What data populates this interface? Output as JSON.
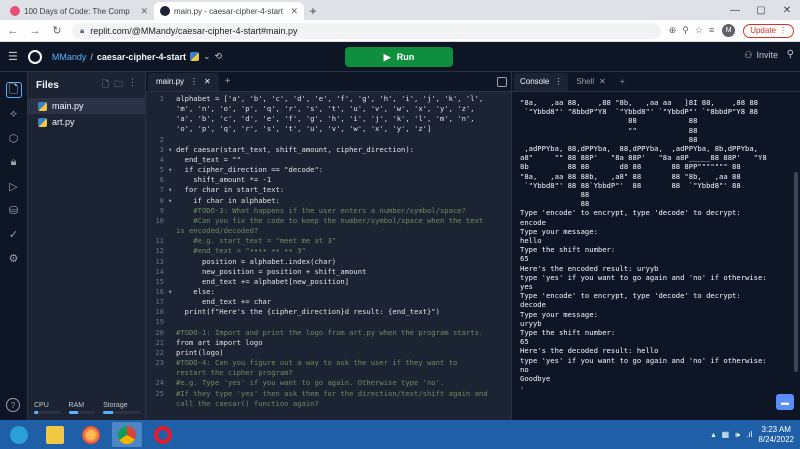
{
  "browser": {
    "tabs": [
      {
        "title": "100 Days of Code: The Comp",
        "favicon_color": "#e94e77",
        "active": false
      },
      {
        "title": "main.py - caesar-cipher-4-start",
        "favicon_color": "#1c2333",
        "active": true
      }
    ],
    "url": "replit.com/@MMandy/caesar-cipher-4-start#main.py",
    "profile_initial": "M",
    "update_label": "Update"
  },
  "header": {
    "user": "MMandy",
    "separator": "/",
    "repo": "caesar-cipher-4-start",
    "run_label": "Run",
    "invite_label": "Invite"
  },
  "files": {
    "title": "Files",
    "items": [
      {
        "name": "main.py",
        "active": true
      },
      {
        "name": "art.py",
        "active": false
      }
    ],
    "resources": [
      {
        "label": "CPU",
        "fraction": 0.15
      },
      {
        "label": "RAM",
        "fraction": 0.35
      },
      {
        "label": "Storage",
        "fraction": 0.25
      }
    ]
  },
  "editor": {
    "tab_label": "main.py",
    "lines": [
      {
        "n": "1",
        "fold": "",
        "text": "alphabet = ['a', 'b', 'c', 'd', 'e', 'f', 'g', 'h', 'i', 'j', 'k', 'l',",
        "comment": false
      },
      {
        "n": "",
        "fold": "",
        "text": "'m', 'n', 'o', 'p', 'q', 'r', 's', 't', 'u', 'v', 'w', 'x', 'y', 'z',",
        "comment": false
      },
      {
        "n": "",
        "fold": "",
        "text": "'a', 'b', 'c', 'd', 'e', 'f', 'g', 'h', 'i', 'j', 'k', 'l', 'm', 'n',",
        "comment": false
      },
      {
        "n": "",
        "fold": "",
        "text": "'o', 'p', 'q', 'r', 's', 't', 'u', 'v', 'w', 'x', 'y', 'z']",
        "comment": false
      },
      {
        "n": "2",
        "fold": "",
        "text": "",
        "comment": false
      },
      {
        "n": "3",
        "fold": "▾",
        "text": "def caesar(start_text, shift_amount, cipher_direction):",
        "comment": false
      },
      {
        "n": "4",
        "fold": "",
        "text": "  end_text = \"\"",
        "comment": false
      },
      {
        "n": "5",
        "fold": "▾",
        "text": "  if cipher_direction == \"decode\":",
        "comment": false
      },
      {
        "n": "6",
        "fold": "",
        "text": "    shift_amount *= -1",
        "comment": false
      },
      {
        "n": "7",
        "fold": "▾",
        "text": "  for char in start_text:",
        "comment": false
      },
      {
        "n": "8",
        "fold": "▾",
        "text": "    if char in alphabet:",
        "comment": false
      },
      {
        "n": "9",
        "fold": "",
        "text": "    #TODO-3: What happens if the user enters a number/symbol/space?",
        "comment": true
      },
      {
        "n": "10",
        "fold": "",
        "text": "    #Can you fix the code to keep the number/symbol/space when the text",
        "comment": true
      },
      {
        "n": "",
        "fold": "",
        "text": "is encoded/decoded?",
        "comment": true
      },
      {
        "n": "11",
        "fold": "",
        "text": "    #e.g. start_text = \"meet me at 3\"",
        "comment": true
      },
      {
        "n": "12",
        "fold": "",
        "text": "    #end_text = \"•••• •• •• 3\"",
        "comment": true
      },
      {
        "n": "13",
        "fold": "",
        "text": "      position = alphabet.index(char)",
        "comment": false
      },
      {
        "n": "14",
        "fold": "",
        "text": "      new_position = position + shift_amount",
        "comment": false
      },
      {
        "n": "15",
        "fold": "",
        "text": "      end_text += alphabet[new_position]",
        "comment": false
      },
      {
        "n": "16",
        "fold": "▾",
        "text": "    else:",
        "comment": false
      },
      {
        "n": "17",
        "fold": "",
        "text": "      end_text += char",
        "comment": false
      },
      {
        "n": "18",
        "fold": "",
        "text": "  print(f\"Here's the {cipher_direction}d result: {end_text}\")",
        "comment": false
      },
      {
        "n": "19",
        "fold": "",
        "text": "",
        "comment": false
      },
      {
        "n": "20",
        "fold": "",
        "text": "#TODO-1: Import and print the logo from art.py when the program starts.",
        "comment": true
      },
      {
        "n": "21",
        "fold": "",
        "text": "from art import logo",
        "comment": false
      },
      {
        "n": "22",
        "fold": "",
        "text": "print(logo)",
        "comment": false
      },
      {
        "n": "23",
        "fold": "",
        "text": "#TODO-4: Can you figure out a way to ask the user if they want to",
        "comment": true
      },
      {
        "n": "",
        "fold": "",
        "text": "restart the cipher program?",
        "comment": true
      },
      {
        "n": "24",
        "fold": "",
        "text": "#e.g. Type 'yes' if you want to go again. Otherwise type 'no'.",
        "comment": true
      },
      {
        "n": "25",
        "fold": "",
        "text": "#If they type 'yes' then ask them for the direction/text/shift again and",
        "comment": true
      },
      {
        "n": "",
        "fold": "",
        "text": "call the caesar() function again?",
        "comment": true
      }
    ]
  },
  "console": {
    "tabs": [
      "Console",
      "Shell"
    ],
    "art": [
      "\"8a,   ,aa 88,    ,88 \"8b,   ,aa aa   ]8I 88,    ,88 88",
      "",
      " `\"Ybbd8\"' \"8bbdP\"Y8  `\"Ybbd8\"' `\"YbbdP\"' `\"8bbdP\"Y8 88",
      "                         88            88",
      "                         \"\"            88",
      "                                       88",
      " ,adPPYba, 88,dPPYba,  88,dPPYba,  ,adPPYba, 8b,dPPYba,",
      "a8\"     \"\" 88 88P'   \"8a 88P'   \"8a a8P_____88 88P'   \"Y8",
      "8b         88 88       d8 88       88 8PP\"\"\"\"\"\"\" 88",
      "\"8a,   ,aa 88 88b,   ,a8\" 88       88 \"8b,   ,aa 88",
      " `\"Ybbd8\"' 88 88`YbbdP\"'  88       88  `\"Ybbd8\"' 88",
      "              88",
      "              88"
    ],
    "lines": [
      "",
      "Type 'encode' to encrypt, type 'decode' to decrypt:",
      "encode",
      "Type your message:",
      "hello",
      "Type the shift number:",
      "65",
      "Here's the encoded result: uryyb",
      "type 'yes' if you want to go again and 'no' if otherwise:",
      "yes",
      "Type 'encode' to encrypt, type 'decode' to decrypt:",
      "decode",
      "Type your message:",
      "uryyb",
      "Type the shift number:",
      "65",
      "Here's the decoded result: hello",
      "type 'yes' if you want to go again and 'no' if otherwise:",
      "no",
      "Goodbye"
    ],
    "prompt": "› "
  },
  "taskbar": {
    "time": "3:23 AM",
    "date": "8/24/2022"
  }
}
